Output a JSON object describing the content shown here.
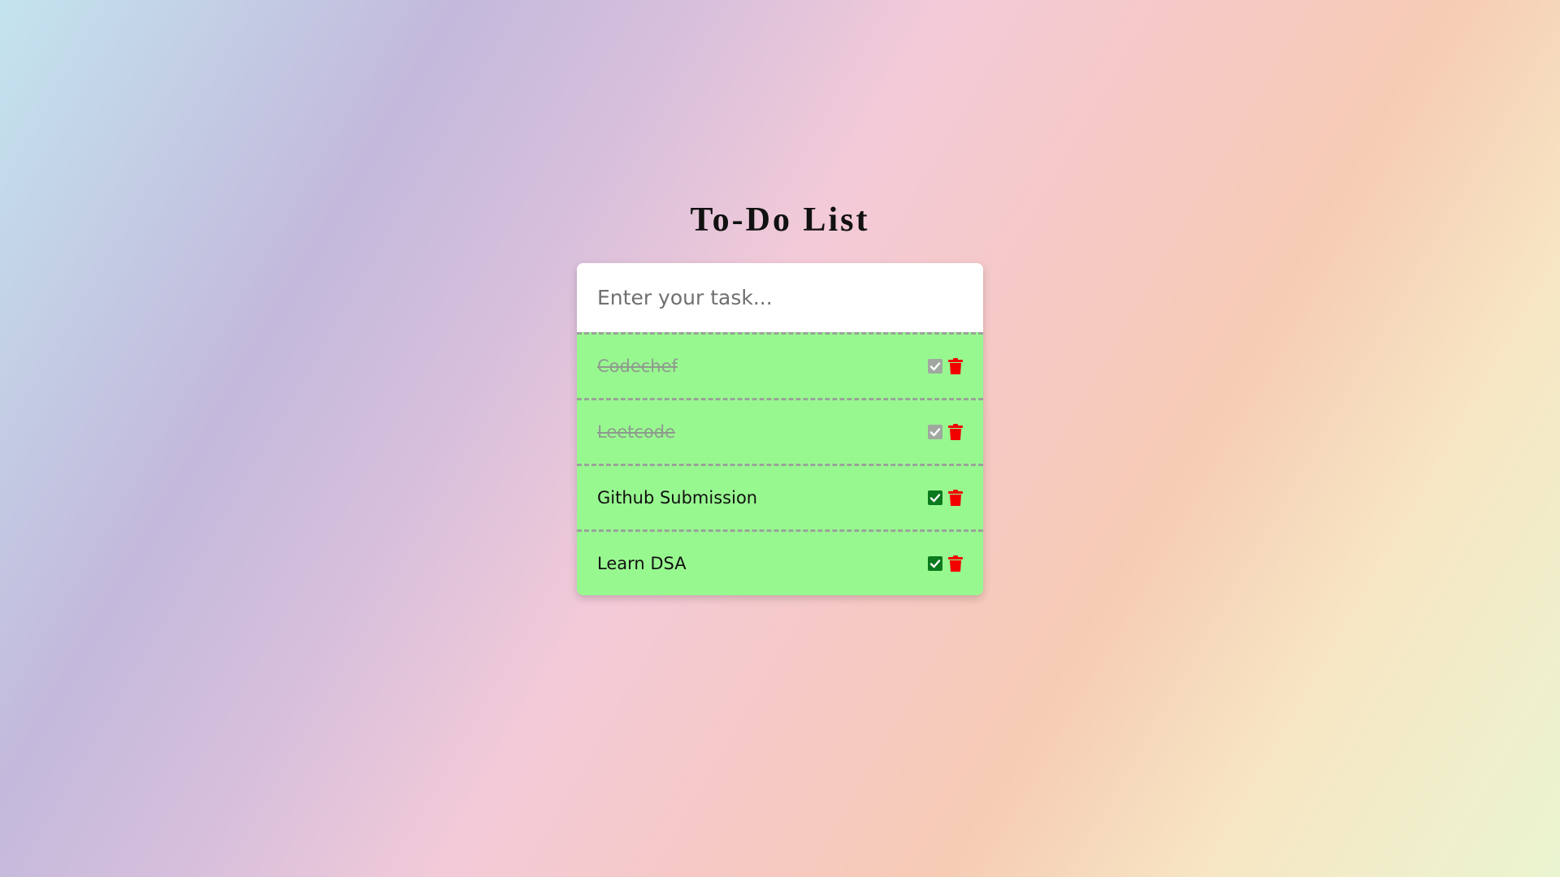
{
  "header": {
    "title": "To-Do List"
  },
  "input": {
    "placeholder": "Enter your task...",
    "value": ""
  },
  "colors": {
    "row_bg": "#98f890",
    "check_done": "#a0a8a0",
    "check_active": "#0a7a1c",
    "trash": "#f20000"
  },
  "tasks": [
    {
      "label": "Codechef",
      "completed": true,
      "check_icon": "check-square-icon",
      "delete_icon": "trash-icon"
    },
    {
      "label": "Leetcode",
      "completed": true,
      "check_icon": "check-square-icon",
      "delete_icon": "trash-icon"
    },
    {
      "label": "Github Submission",
      "completed": false,
      "check_icon": "check-square-icon",
      "delete_icon": "trash-icon"
    },
    {
      "label": "Learn DSA",
      "completed": false,
      "check_icon": "check-square-icon",
      "delete_icon": "trash-icon"
    }
  ]
}
